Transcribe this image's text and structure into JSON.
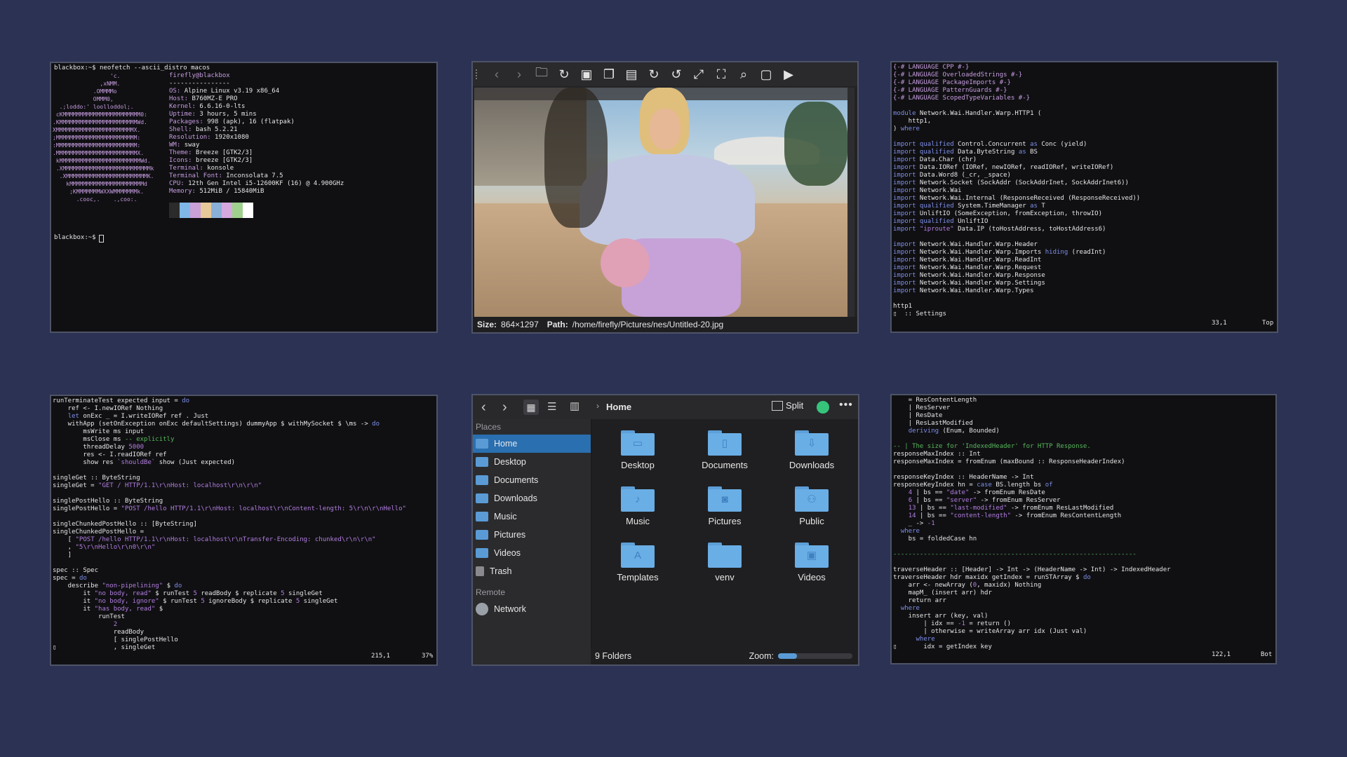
{
  "neofetch": {
    "prompt_cmd": "blackbox:~$ neofetch --ascii_distro macos",
    "user_host": "firefly@blackbox",
    "separator": "----------------",
    "info": [
      {
        "label": "OS",
        "value": "Alpine Linux v3.19 x86_64"
      },
      {
        "label": "Host",
        "value": "B760MZ-E PRO"
      },
      {
        "label": "Kernel",
        "value": "6.6.16-0-lts"
      },
      {
        "label": "Uptime",
        "value": "3 hours, 5 mins"
      },
      {
        "label": "Packages",
        "value": "998 (apk), 16 (flatpak)"
      },
      {
        "label": "Shell",
        "value": "bash 5.2.21"
      },
      {
        "label": "Resolution",
        "value": "1920x1080"
      },
      {
        "label": "WM",
        "value": "sway"
      },
      {
        "label": "Theme",
        "value": "Breeze [GTK2/3]"
      },
      {
        "label": "Icons",
        "value": "breeze [GTK2/3]"
      },
      {
        "label": "Terminal",
        "value": "konsole"
      },
      {
        "label": "Terminal Font",
        "value": "Inconsolata 7.5"
      },
      {
        "label": "CPU",
        "value": "12th Gen Intel i5-12600KF (16) @ 4.900GHz"
      },
      {
        "label": "Memory",
        "value": "512MiB / 15840MiB"
      }
    ],
    "palette": [
      "#2b2b2b",
      "#7fb7e8",
      "#c9a0d8",
      "#e8c99a",
      "#8ab0d8",
      "#d6a8e0",
      "#9fd08e",
      "#ffffff"
    ],
    "prompt_end": "blackbox:~$"
  },
  "viewer": {
    "size_label": "Size:",
    "size_value": "864×1297",
    "path_label": "Path:",
    "path_value": "/home/firefly/Pictures/nes/Untitled-20.jpg"
  },
  "haskell_top": {
    "cursor_pos": "33,1",
    "scroll_pos": "Top"
  },
  "haskell_left": {
    "cursor_pos": "215,1",
    "scroll_pos": "37%"
  },
  "haskell_right": {
    "cursor_pos": "122,1",
    "scroll_pos": "Bot"
  },
  "filemanager": {
    "breadcrumb": "Home",
    "split_label": "Split",
    "places_header": "Places",
    "remote_header": "Remote",
    "places": [
      "Home",
      "Desktop",
      "Documents",
      "Downloads",
      "Music",
      "Pictures",
      "Videos",
      "Trash"
    ],
    "remote": [
      "Network"
    ],
    "folders": [
      "Desktop",
      "Documents",
      "Downloads",
      "Music",
      "Pictures",
      "Public",
      "Templates",
      "venv",
      "Videos"
    ],
    "status": "9 Folders",
    "zoom_label": "Zoom:",
    "zoom_level": 0.25
  }
}
